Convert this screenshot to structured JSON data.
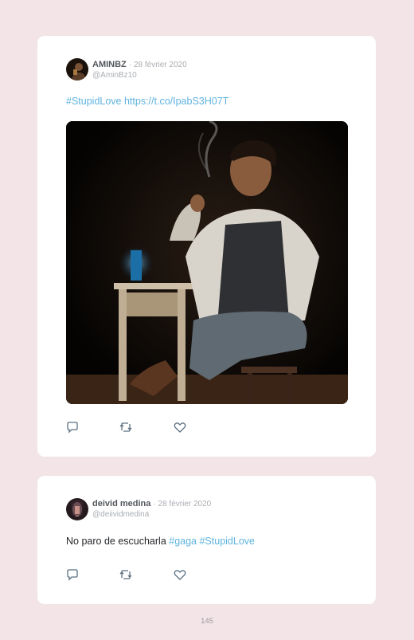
{
  "tweets": [
    {
      "name": "AMINBZ",
      "date": "· 28 février 2020",
      "handle": "@AminBz10",
      "text_parts": [
        "",
        "#StupidLove https://t.co/IpabS3H07T",
        ""
      ],
      "has_image": true,
      "icons": [
        "reply-icon",
        "retweet-icon",
        "like-icon"
      ]
    },
    {
      "name": "deivid medina",
      "date": "· 28 février 2020",
      "handle": "@deiividmedina",
      "text_parts": [
        "No paro de escucharla ",
        "#gaga #StupidLove",
        ""
      ],
      "has_image": false,
      "icons": [
        "reply-icon",
        "retweet-icon",
        "like-icon"
      ]
    }
  ],
  "page_number": "145",
  "colors": {
    "background": "#f2e4e7",
    "card": "#ffffff",
    "link": "#5fb3de",
    "name": "#53575c",
    "muted": "#a9adb2",
    "icon": "#5b7083"
  }
}
